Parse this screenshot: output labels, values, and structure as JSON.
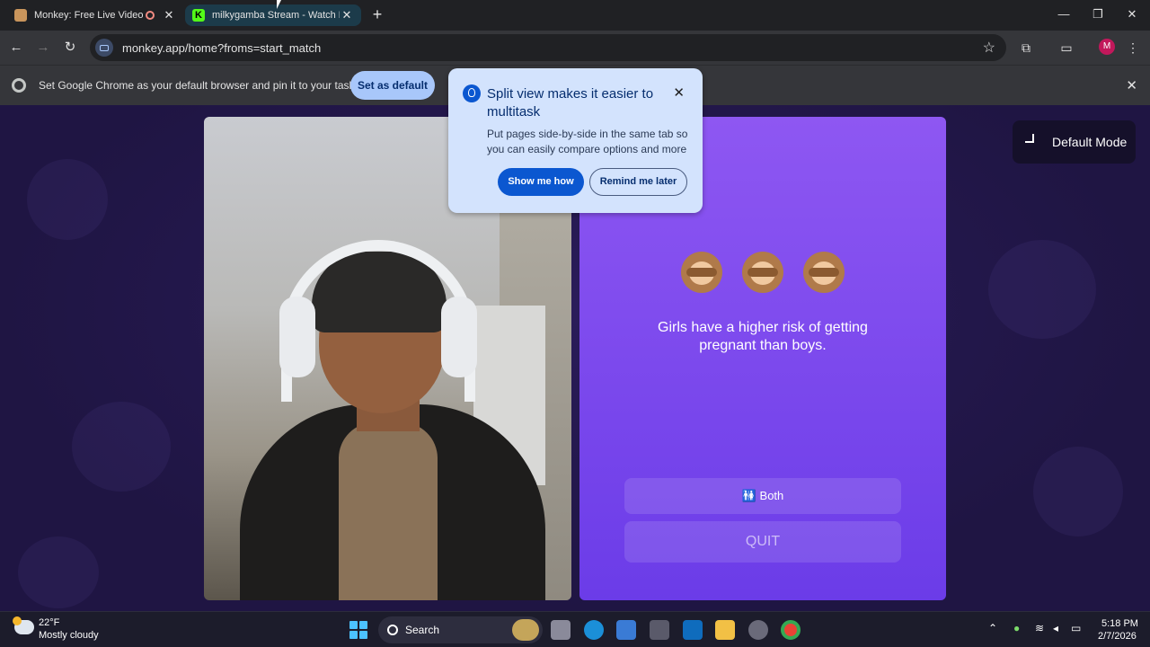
{
  "browser": {
    "tabs": [
      {
        "title": "Monkey: Free Live Video Ch",
        "favicon": "monkey-icon",
        "recording": true
      },
      {
        "title": "milkygamba Stream - Watch Liv",
        "favicon": "kick-icon",
        "favicon_letter": "K",
        "active": true
      }
    ],
    "new_tab_label": "+",
    "window": {
      "minimize": "—",
      "restore": "❐",
      "close": "✕"
    },
    "nav": {
      "back": "←",
      "forward": "→",
      "reload": "↻"
    },
    "url": "monkey.app/home?froms=start_match",
    "profile_initial": "M",
    "star": "☆"
  },
  "infobar": {
    "text": "Set Google Chrome as your default browser and pin it to your taskbar",
    "button": "Set as default",
    "close": "✕"
  },
  "popup": {
    "title": "Split view makes it easier to multitask",
    "body": "Put pages side-by-side in the same tab so you can easily compare options and more",
    "primary": "Show me how",
    "secondary": "Remind me later",
    "close": "✕"
  },
  "page": {
    "mode_button": "Default Mode",
    "emojis": [
      "speak-no-evil-monkey",
      "see-no-evil-monkey",
      "hear-no-evil-monkey"
    ],
    "statement": "Girls have a higher risk of getting pregnant than boys.",
    "answer_button": "🚻 Both",
    "quit_button": "QUIT"
  },
  "taskbar": {
    "temperature": "22°F",
    "condition": "Mostly cloudy",
    "search_label": "Search",
    "time": "5:18 PM",
    "date": "2/7/2026"
  },
  "colors": {
    "page_bg": "#1f1543",
    "card_top": "#8e57f2",
    "card_bottom": "#6b3ce8",
    "popup_bg": "#d3e3fd",
    "accent": "#0b57d0"
  }
}
